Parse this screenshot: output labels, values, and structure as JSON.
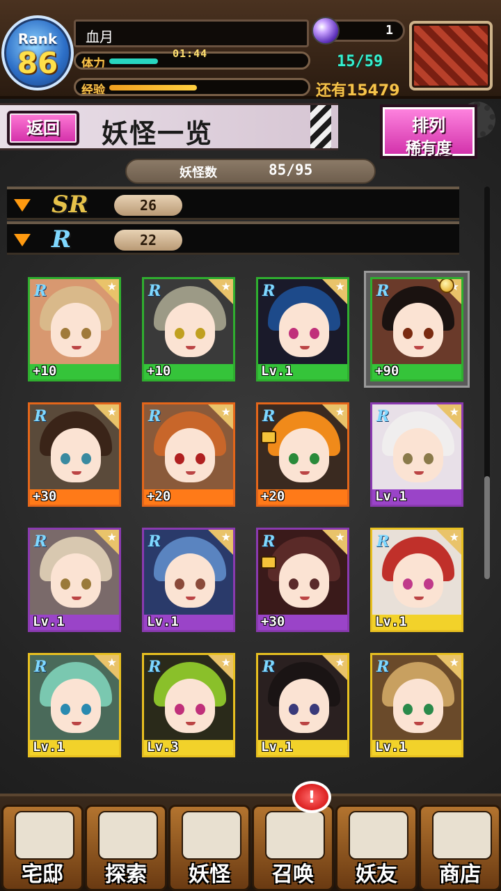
{
  "header": {
    "rank_label": "Rank",
    "rank_value": "86",
    "player_name": "血月",
    "stamina_label": "体力",
    "stamina_timer": "01:44",
    "stamina_value": "15/59",
    "stamina_fraction": 0.25,
    "exp_label": "经验",
    "exp_fraction": 0.45,
    "orb_count": "1",
    "remaining_label": "还有15479"
  },
  "title_bar": {
    "back_label": "返回",
    "title": "妖怪一览",
    "sort_label_1": "排列",
    "sort_label_2": "稀有度"
  },
  "collection": {
    "count_label": "妖怪数",
    "count_value": "85/95"
  },
  "rarity_groups": [
    {
      "badge": "SR",
      "count": "26",
      "color": "#e6c24a"
    },
    {
      "badge": "R",
      "count": "22",
      "color": "#7fd8ff"
    }
  ],
  "cards": [
    {
      "rarity": "R",
      "level": "+10",
      "frame": "#2fae2f",
      "bar": "#35c43a",
      "hair": "#d9b98a",
      "eye": "#a07a3a",
      "bg": "#d89870"
    },
    {
      "rarity": "R",
      "level": "+10",
      "frame": "#2fae2f",
      "bar": "#35c43a",
      "hair": "#9c9a86",
      "eye": "#c0a020",
      "bg": "#3a3a3a"
    },
    {
      "rarity": "R",
      "level": "Lv.1",
      "frame": "#2fae2f",
      "bar": "#35c43a",
      "hair": "#1d4a8a",
      "eye": "#c0307a",
      "bg": "#1a1a2a"
    },
    {
      "rarity": "R",
      "level": "+90",
      "frame": "#2fae2f",
      "bar": "#35c43a",
      "hair": "#1a1210",
      "eye": "#7a2a10",
      "bg": "#6a3a2a",
      "medal": true,
      "selected": true
    },
    {
      "rarity": "R",
      "level": "+30",
      "frame": "#e4661a",
      "bar": "#ff7a18",
      "hair": "#3a2418",
      "eye": "#3a8aa0",
      "bg": "#5a4a3a"
    },
    {
      "rarity": "R",
      "level": "+20",
      "frame": "#e4661a",
      "bar": "#ff7a18",
      "hair": "#c8662a",
      "eye": "#b02020",
      "bg": "#8a5a3a"
    },
    {
      "rarity": "R",
      "level": "+20",
      "frame": "#e4661a",
      "bar": "#ff7a18",
      "hair": "#f08a1a",
      "eye": "#2a8a3a",
      "bg": "#3a2a20",
      "lock": true
    },
    {
      "rarity": "R",
      "level": "Lv.1",
      "frame": "#8a3ab0",
      "bar": "#9a44c8",
      "hair": "#f0eeee",
      "eye": "#8a7a4a",
      "bg": "#e8e0e8"
    },
    {
      "rarity": "R",
      "level": "Lv.1",
      "frame": "#8a3ab0",
      "bar": "#9a44c8",
      "hair": "#d8c8b0",
      "eye": "#9a7a3a",
      "bg": "#7a6a6a"
    },
    {
      "rarity": "R",
      "level": "Lv.1",
      "frame": "#8a3ab0",
      "bar": "#9a44c8",
      "hair": "#5a84c0",
      "eye": "#8a4a3a",
      "bg": "#2a3a6a"
    },
    {
      "rarity": "R",
      "level": "+30",
      "frame": "#8a3ab0",
      "bar": "#9a44c8",
      "hair": "#5a2a28",
      "eye": "#5a2a2a",
      "bg": "#3a1a1a",
      "lock": true
    },
    {
      "rarity": "R",
      "level": "Lv.1",
      "frame": "#e8c020",
      "bar": "#f2d22a",
      "hair": "#c0302a",
      "eye": "#c03a8a",
      "bg": "#e8e0d8"
    },
    {
      "rarity": "R",
      "level": "Lv.1",
      "frame": "#e8c020",
      "bar": "#f2d22a",
      "hair": "#7ac8b0",
      "eye": "#2a8ab0",
      "bg": "#4a6a5a"
    },
    {
      "rarity": "R",
      "level": "Lv.3",
      "frame": "#e8c020",
      "bar": "#f2d22a",
      "hair": "#8ac02a",
      "eye": "#c0307a",
      "bg": "#2a2a1a"
    },
    {
      "rarity": "R",
      "level": "Lv.1",
      "frame": "#e8c020",
      "bar": "#f2d22a",
      "hair": "#1a1414",
      "eye": "#3a3a7a",
      "bg": "#2a2020"
    },
    {
      "rarity": "R",
      "level": "Lv.1",
      "frame": "#e8c020",
      "bar": "#f2d22a",
      "hair": "#c8a060",
      "eye": "#2a8a4a",
      "bg": "#6a4a2a"
    }
  ],
  "nav": [
    {
      "label": "宅邸",
      "icon": "mansion-icon"
    },
    {
      "label": "探索",
      "icon": "magnifier-icon"
    },
    {
      "label": "妖怪",
      "icon": "scroll-icon"
    },
    {
      "label": "召唤",
      "icon": "pentagram-icon"
    },
    {
      "label": "妖友",
      "icon": "friend-icon"
    },
    {
      "label": "商店",
      "icon": "orb-icon"
    }
  ],
  "alert_badge": "!"
}
